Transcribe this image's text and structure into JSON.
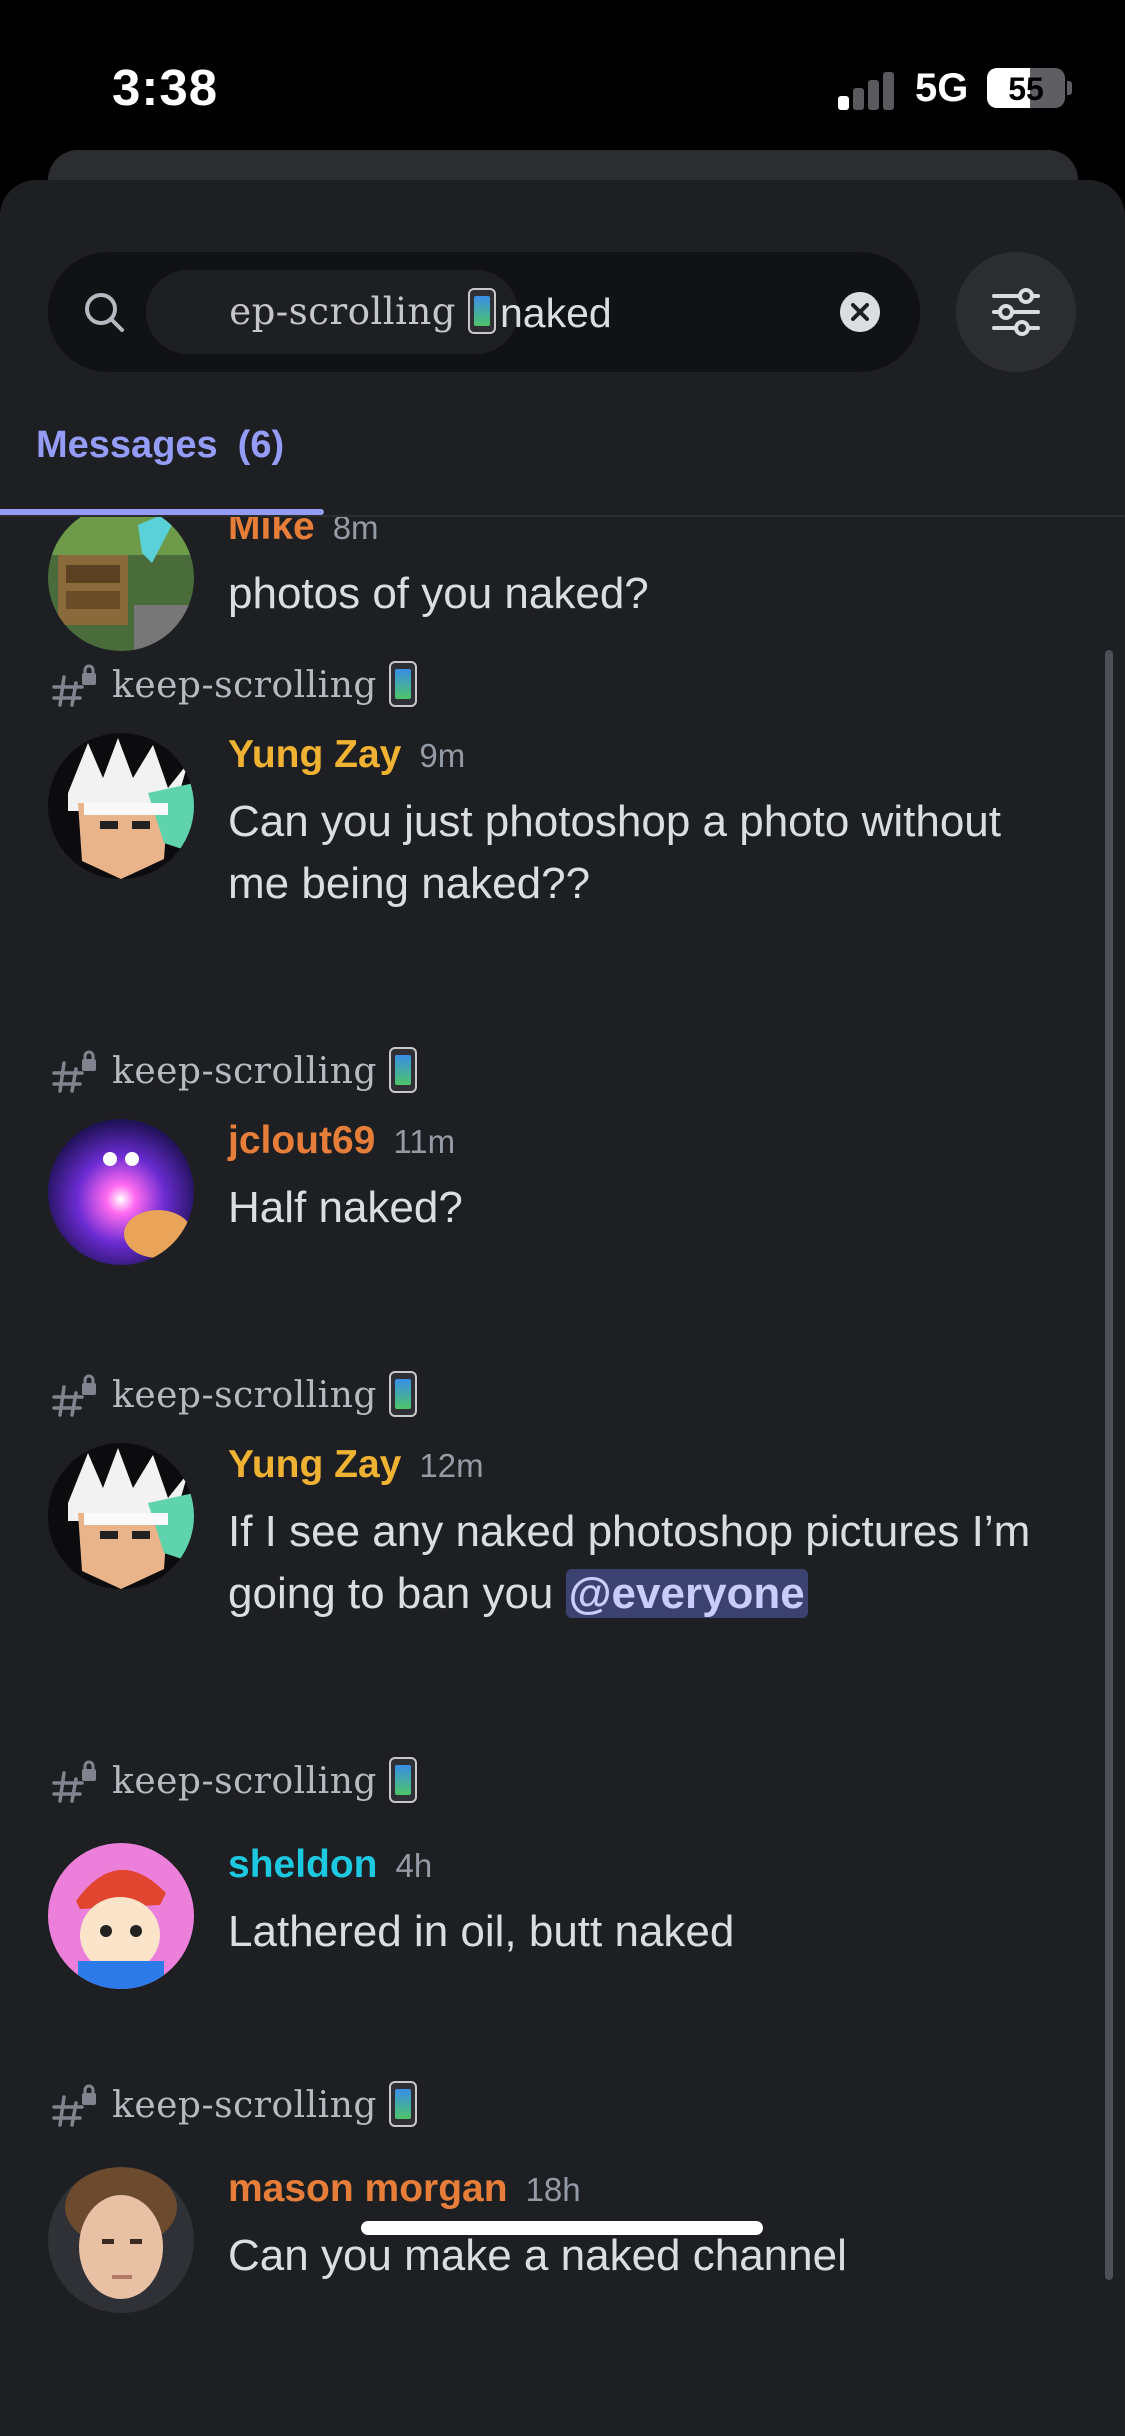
{
  "status_bar": {
    "time": "3:38",
    "network": "5G",
    "battery_percent": "55",
    "battery_level": 0.55
  },
  "search": {
    "channel_chip": "ep-scrolling",
    "query": "naked",
    "icons": {
      "search": "search-icon",
      "clear": "clear-icon",
      "filter": "filter-sliders-icon"
    }
  },
  "tabs": [
    {
      "label": "Messages",
      "count": "(6)",
      "active": true
    }
  ],
  "results": [
    {
      "author": "Mike",
      "author_color": "#e67e3a",
      "time": "8m",
      "text": "photos of you naked?"
    },
    {
      "channel": "keep-scrolling",
      "author": "Yung Zay",
      "author_color": "#f0b232",
      "time": "9m",
      "text": "Can you just photoshop a photo without me being naked??"
    },
    {
      "channel": "keep-scrolling",
      "author": "jclout69",
      "author_color": "#e67e3a",
      "time": "11m",
      "text": "Half naked?"
    },
    {
      "channel": "keep-scrolling",
      "author": "Yung Zay",
      "author_color": "#f0b232",
      "time": "12m",
      "text": "If I see any naked photoshop pictures I’m going to ban you",
      "mention": "@everyone"
    },
    {
      "channel": "keep-scrolling",
      "author": "sheldon",
      "author_color": "#1dc9e0",
      "time": "4h",
      "text": "Lathered in oil, butt naked"
    },
    {
      "channel": "keep-scrolling",
      "author": "mason morgan",
      "author_color": "#e67e3a",
      "time": "18h",
      "text": "Can you make a naked channel"
    }
  ],
  "colors": {
    "background": "#1e1f22",
    "accent": "#949cf7",
    "mention_bg": "#3c4270"
  }
}
